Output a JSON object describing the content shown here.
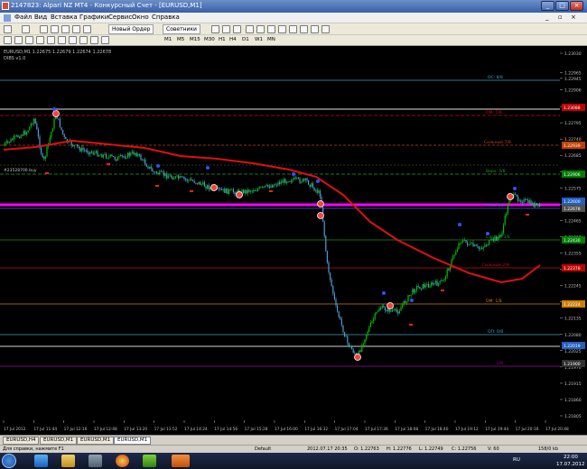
{
  "window": {
    "title": "2147823: Alpari NZ MT4 - Конкурсный Счет - [EURUSD,M1]"
  },
  "menu": [
    "Файл",
    "Вид",
    "Вставка",
    "Графики",
    "Сервис",
    "Окно",
    "Справка"
  ],
  "toolbar": {
    "new_order_label": "Новый Ордер",
    "experts_label": "Советники"
  },
  "timeframes": [
    "M1",
    "M5",
    "M15",
    "M30",
    "H1",
    "H4",
    "D1",
    "W1",
    "MN"
  ],
  "chart": {
    "header_line1": "EURUSD,M1  1.22675 1.22679 1.22674 1.22678",
    "header_line2": "DIBS v1.0",
    "price_ticks": [
      "1.23030",
      "1.22965",
      "1.22945",
      "1.22906",
      "1.22850",
      "1.22795",
      "1.22740",
      "1.22685",
      "1.22630",
      "1.22575",
      "1.22520",
      "1.22465",
      "1.22410",
      "1.22355",
      "1.22300",
      "1.22245",
      "1.22190",
      "1.22135",
      "1.22080",
      "1.22025",
      "1.21970",
      "1.21915",
      "1.21860",
      "1.21805"
    ],
    "price_highlights": [
      {
        "label": "1.23088",
        "color": "#c00000"
      },
      {
        "label": "1.22939",
        "color": "#c04000"
      },
      {
        "label": "1.22906",
        "color": "#008000"
      },
      {
        "label": "1.22678",
        "color": "#505050"
      },
      {
        "label": "1.22600",
        "color": "#2060c0"
      },
      {
        "label": "1.22430",
        "color": "#008000"
      },
      {
        "label": "1.22378",
        "color": "#c00000"
      },
      {
        "label": "1.22224",
        "color": "#d08000"
      },
      {
        "label": "1.22019",
        "color": "#2060c0"
      },
      {
        "label": "1.21900",
        "color": "#303030"
      }
    ],
    "level_labels": {
      "oc_top": "OC: 8/8",
      "om_78": "OM: 7/8",
      "wall_78": "Сильный 7/8",
      "vert_58": "Верх: 5/8",
      "pivot_48": "Pivot 4/8",
      "weak_38": "Слабый 3/8",
      "wall_28": "Сильный 2/8",
      "om_18": "OM: 1/8",
      "oc_08": "OП: 0/8",
      "minus18": "-1/8",
      "buy_order": "#23528700 buy"
    },
    "time_ticks": [
      "17 Jul 2012",
      "17 Jul 11:44",
      "17 Jul 12:16",
      "17 Jul 12:48",
      "17 Jul 13:20",
      "17 Jul 13:52",
      "17 Jul 14:24",
      "17 Jul 14:56",
      "17 Jul 15:28",
      "17 Jul 16:00",
      "17 Jul 16:32",
      "17 Jul 17:04",
      "17 Jul 17:36",
      "17 Jul 18:08",
      "17 Jul 18:40",
      "17 Jul 19:12",
      "17 Jul 19:44",
      "17 Jul 20:16",
      "17 Jul 20:48"
    ],
    "colors": {
      "candle_up": "#00c000",
      "candle_down": "#4a9cd8",
      "ma": "#e01010",
      "magenta_line": "#ff00ff",
      "background": "#000000"
    }
  },
  "tabs": [
    "EURUSD,H4",
    "EURUSD,M1",
    "EURUSD,M1",
    "EURUSD,M1"
  ],
  "statusbar": {
    "help": "Для справки, нажмите F1",
    "profile": "Default",
    "datetime": "2012.07.17 20:35",
    "open": "O: 1.22763",
    "high": "H: 1.22776",
    "low": "L: 1.22749",
    "close": "C: 1.22756",
    "volume": "V: 60",
    "traffic": "158/0 kb"
  },
  "taskbar": {
    "lang": "RU",
    "time": "22:00",
    "date": "17.07.2012"
  }
}
